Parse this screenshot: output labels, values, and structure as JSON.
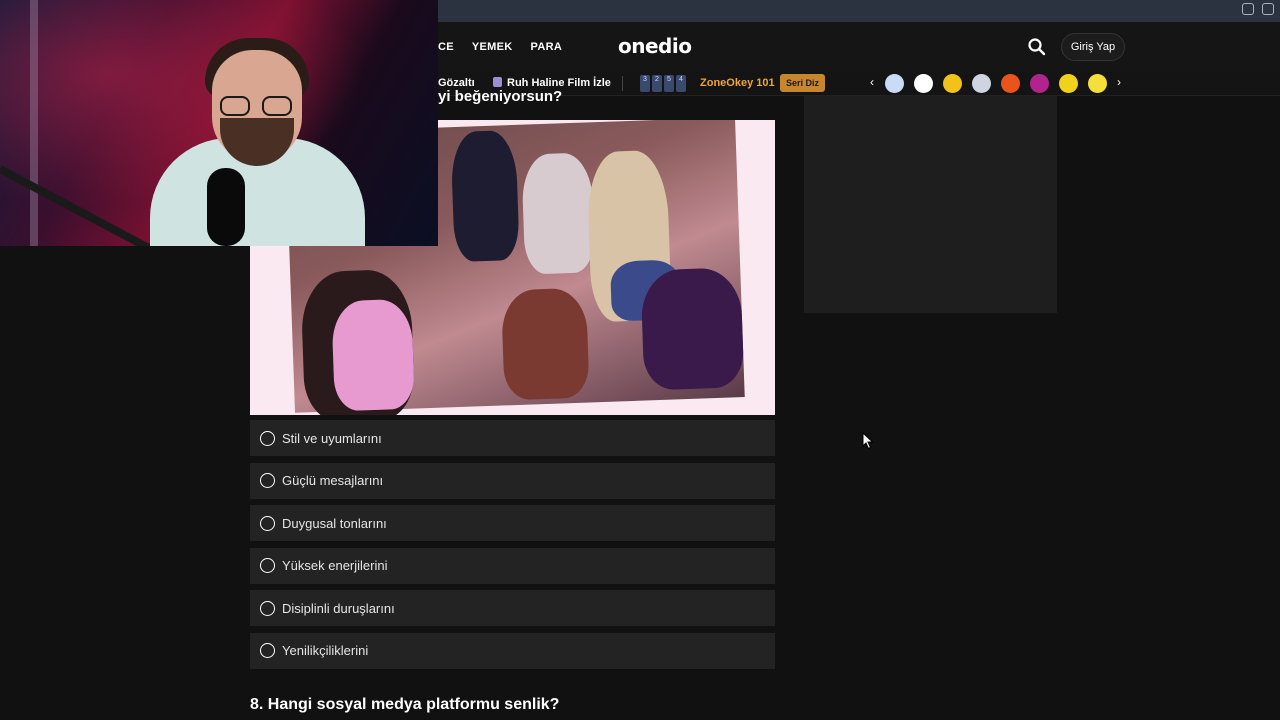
{
  "header": {
    "nav": [
      "CE",
      "YEMEK",
      "PARA"
    ],
    "logo": "onedio",
    "login": "Giriş Yap"
  },
  "subbar": {
    "item1": "Gözaltı",
    "item2": "Ruh Haline Film İzle",
    "num_badges": [
      "3",
      "2",
      "5",
      "4"
    ],
    "item3": "ZoneOkey 101",
    "seri_diz": "Seri Diz",
    "circle_colors": [
      "#c9dbf5",
      "#ffffff",
      "#f2c21b",
      "#d0d4e0",
      "#e8541c",
      "#b1238e",
      "#f0d21a",
      "#f5e03a"
    ]
  },
  "question": {
    "title_fragment": "yi beğeniyorsun?",
    "options": [
      "Stil ve uyumlarını",
      "Güçlü mesajlarını",
      "Duygusal tonlarını",
      "Yüksek enerjilerini",
      "Disiplinli duruşlarını",
      "Yenilikçiliklerini"
    ]
  },
  "next_question": "8. Hangi sosyal medya platformu senlik?"
}
